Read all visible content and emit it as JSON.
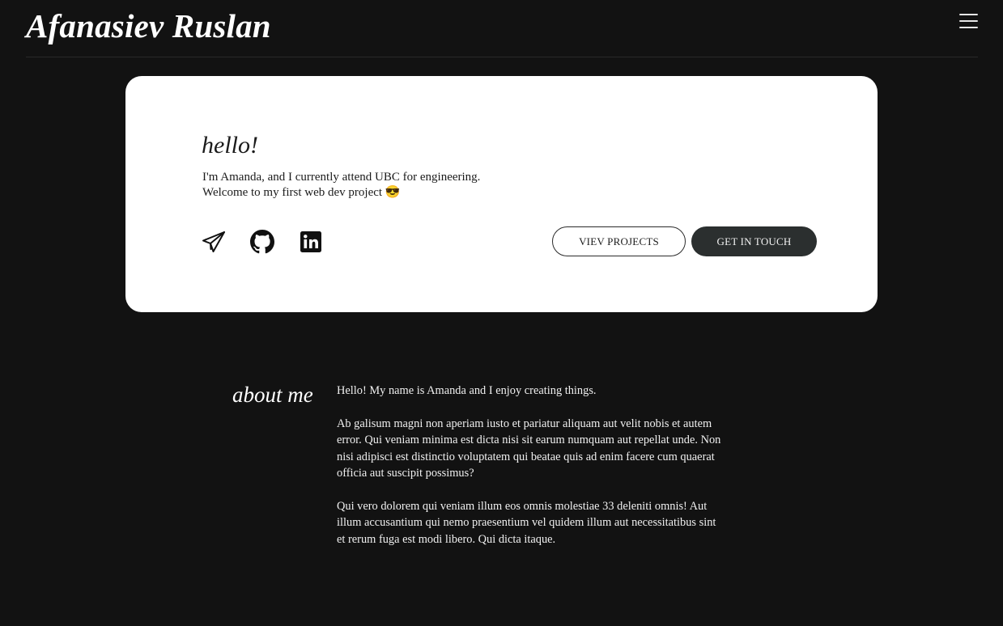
{
  "header": {
    "title": "Afanasiev Ruslan",
    "menu_icon": "hamburger-menu-icon"
  },
  "hero": {
    "greeting": "hello!",
    "intro_line1": "I'm Amanda, and I currently attend UBC for engineering.",
    "intro_line2": "Welcome to my first web dev project 😎",
    "socials": [
      {
        "icon": "telegram-icon"
      },
      {
        "icon": "github-icon"
      },
      {
        "icon": "linkedin-icon"
      }
    ],
    "view_projects_label": "VIEV PROJECTS",
    "get_in_touch_label": "GET IN TOUCH"
  },
  "about": {
    "title": "about me",
    "paragraphs": [
      "Hello! My name is Amanda and I enjoy creating things.",
      "Ab galisum magni non aperiam iusto et pariatur aliquam aut velit nobis et autem error. Qui veniam minima est dicta nisi sit earum numquam aut repellat unde. Non nisi adipisci est distinctio voluptatem qui beatae quis ad enim facere cum quaerat officia aut suscipit possimus?",
      "Qui vero dolorem qui veniam illum eos omnis molestiae 33 deleniti omnis! Aut illum accusantium qui nemo praesentium vel quidem illum aut necessitatibus sint et rerum fuga est modi libero. Qui dicta itaque."
    ]
  },
  "colors": {
    "background": "#121212",
    "card": "#ffffff",
    "button_dark": "#2b2f2f",
    "text_light": "#ffffff",
    "text_dark": "#1b1b1b"
  }
}
